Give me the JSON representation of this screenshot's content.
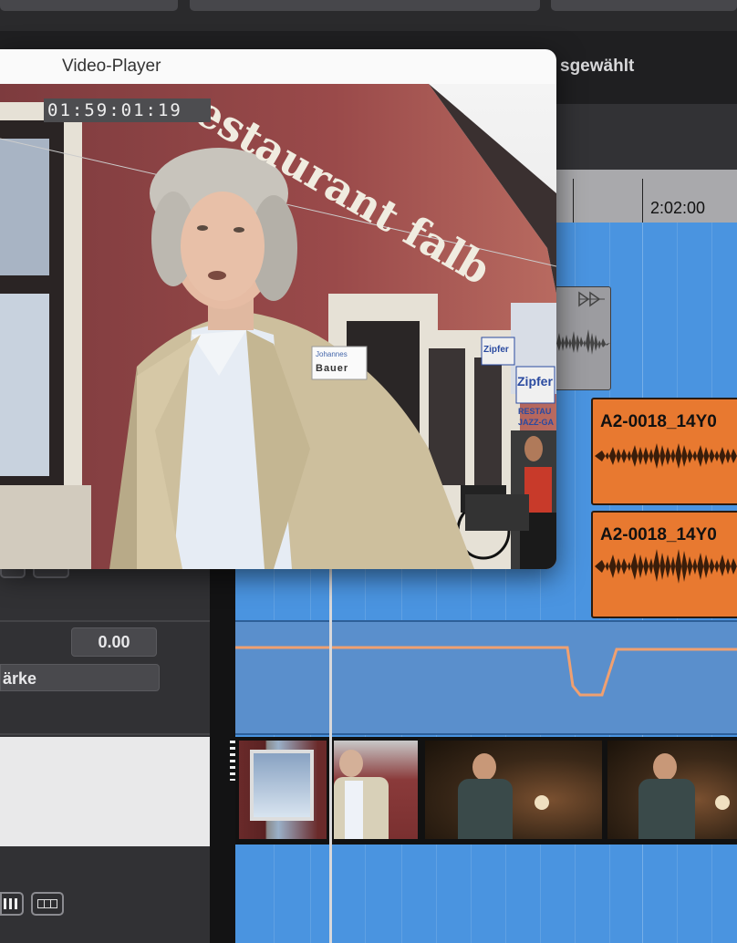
{
  "video_player": {
    "title": "Video-Player",
    "timecode": "01:59:01:19",
    "sign_text": "estaurant falb",
    "badge_line1": "Johannes",
    "badge_line2": "Bauer",
    "ad_sign1": "Zipfer",
    "ad_sign2": "Zipfer",
    "restaurant_sign_1": "RESTAU",
    "restaurant_sign_2": "JAZZ-GA"
  },
  "header": {
    "selection_text": "sgewählt"
  },
  "ruler": {
    "time_label": "2:02:00"
  },
  "left_panel": {
    "value": "0.00",
    "field_label": "ärke"
  },
  "clips": {
    "audio1": "A2-0018_14Y0",
    "audio2": "A2-0018_14Y0"
  },
  "colors": {
    "timeline_blue": "#4a94e0",
    "audio_clip_orange": "#e87930",
    "automation_line": "#f0a070"
  },
  "icons": [
    "grid-view-icon",
    "piano-keys-icon",
    "play-triangle-icon"
  ]
}
